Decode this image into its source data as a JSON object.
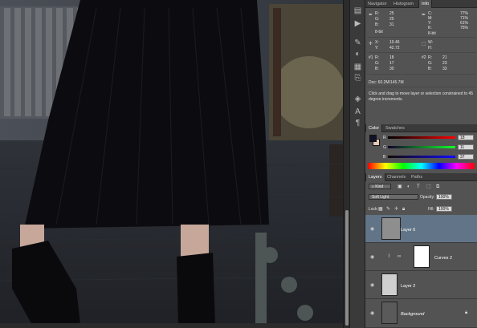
{
  "toolbar_icons": [
    "history-icon",
    "actions-icon",
    "brush-icon",
    "adjust-icon",
    "swatch-icon",
    "clone-icon",
    "layers-icon",
    "text-icon",
    "paragraph-icon"
  ],
  "info_panel": {
    "tabs": [
      {
        "label": "Navigator"
      },
      {
        "label": "Histogram"
      },
      {
        "label": "Info"
      }
    ],
    "active_tab": 2,
    "rgb": {
      "r_label": "R:",
      "r": "25",
      "g_label": "G:",
      "g": "25",
      "b_label": "B:",
      "b": "31"
    },
    "cmyk": {
      "c_label": "C:",
      "c": "77%",
      "m_label": "M:",
      "m": "71%",
      "y_label": "Y:",
      "y": "61%",
      "k_label": "K:",
      "k": "75%"
    },
    "bit_left": "8-bit",
    "bit_right": "8-bit",
    "xy": {
      "x_label": "X:",
      "x": "10.46",
      "y_label": "Y:",
      "y": "42.72"
    },
    "wh": {
      "w_label": "W:",
      "h_label": "H:"
    },
    "sample1": {
      "id": "#1",
      "r": "18",
      "g": "17",
      "b": "30"
    },
    "sample2": {
      "id": "#2",
      "r": "21",
      "g": "23",
      "b": "33"
    },
    "doc": "Doc: 60.2M/145.7M",
    "hint": "Click and drag to move layer or selection constrained to 45 degree increments."
  },
  "color_panel": {
    "tabs": [
      {
        "label": "Color"
      },
      {
        "label": "Swatches"
      }
    ],
    "r_label": "R",
    "r": "18",
    "g_label": "G",
    "g": "11",
    "b_label": "B",
    "b": "37",
    "fg": "#12112a",
    "bg": "#e8c9b4"
  },
  "layers_panel": {
    "tabs": [
      {
        "label": "Layers"
      },
      {
        "label": "Channels"
      },
      {
        "label": "Paths"
      }
    ],
    "kind": "Kind",
    "blend_mode": "Soft Light",
    "opacity_label": "Opacity:",
    "opacity": "100%",
    "lock_label": "Lock:",
    "fill_label": "Fill:",
    "fill": "100%",
    "layers": [
      {
        "name": "Layer 6",
        "selected": true
      },
      {
        "name": "Curves 2",
        "selected": false
      },
      {
        "name": "Layer 2",
        "selected": false
      },
      {
        "name": "Background",
        "selected": false
      }
    ]
  }
}
